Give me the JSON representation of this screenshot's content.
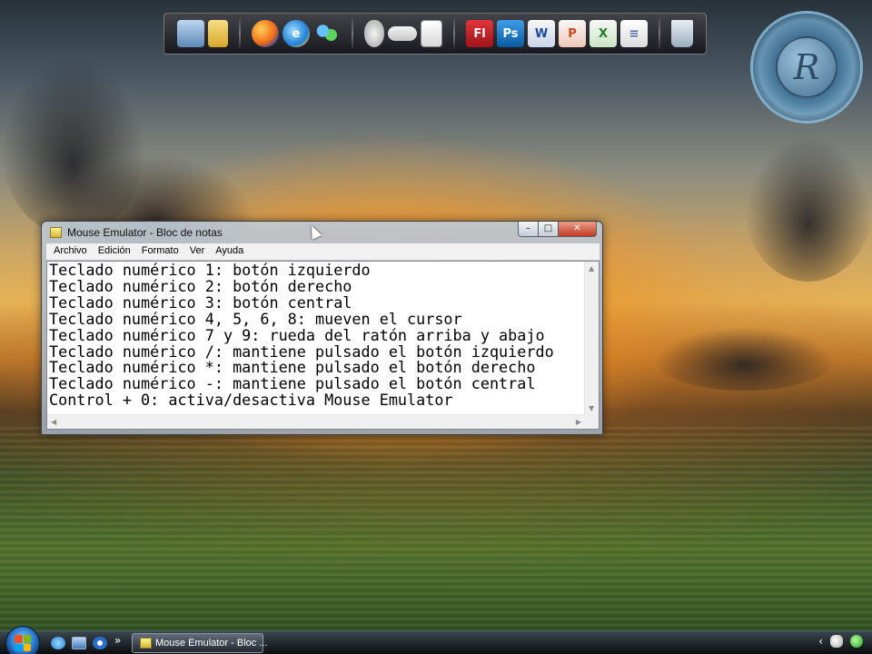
{
  "colors": {
    "titlebar_text": "#111111",
    "editor_bg": "#ffffff",
    "close_button": "#c23a22",
    "taskbar_bg": "#14181e"
  },
  "dock": {
    "icons": [
      {
        "name": "computer-icon",
        "text": ""
      },
      {
        "name": "folder-icon",
        "text": ""
      },
      {
        "name": "firefox-icon",
        "text": ""
      },
      {
        "name": "internet-explorer-icon",
        "text": "e"
      },
      {
        "name": "messenger-icon",
        "text": ""
      },
      {
        "name": "mouse-icon",
        "text": ""
      },
      {
        "name": "keyboard-icon",
        "text": ""
      },
      {
        "name": "notepad-icon",
        "text": ""
      },
      {
        "name": "flash-icon",
        "text": "Fl"
      },
      {
        "name": "photoshop-icon",
        "text": "Ps"
      },
      {
        "name": "word-icon",
        "text": "W"
      },
      {
        "name": "powerpoint-icon",
        "text": "P"
      },
      {
        "name": "excel-icon",
        "text": "X"
      },
      {
        "name": "document-icon",
        "text": "≡"
      },
      {
        "name": "recycle-bin-icon",
        "text": ""
      }
    ]
  },
  "logo": {
    "letter": "R"
  },
  "window": {
    "title": "Mouse Emulator - Bloc de notas",
    "controls": {
      "minimize": "–",
      "maximize": "□",
      "close": "✕"
    },
    "menu": [
      "Archivo",
      "Edición",
      "Formato",
      "Ver",
      "Ayuda"
    ],
    "lines": [
      "Teclado numérico 1: botón izquierdo",
      "Teclado numérico 2: botón derecho",
      "Teclado numérico 3: botón central",
      "Teclado numérico 4, 5, 6, 8: mueven el cursor",
      "Teclado numérico 7 y 9: rueda del ratón arriba y abajo",
      "Teclado numérico /: mantiene pulsado el botón izquierdo",
      "Teclado numérico *: mantiene pulsado el botón derecho",
      "Teclado numérico -: mantiene pulsado el botón central",
      "Control + 0: activa/desactiva Mouse Emulator"
    ]
  },
  "taskbar": {
    "quicklaunch_chevron": "»",
    "task_label": "Mouse Emulator - Bloc ...",
    "tray_chevron": "‹"
  }
}
